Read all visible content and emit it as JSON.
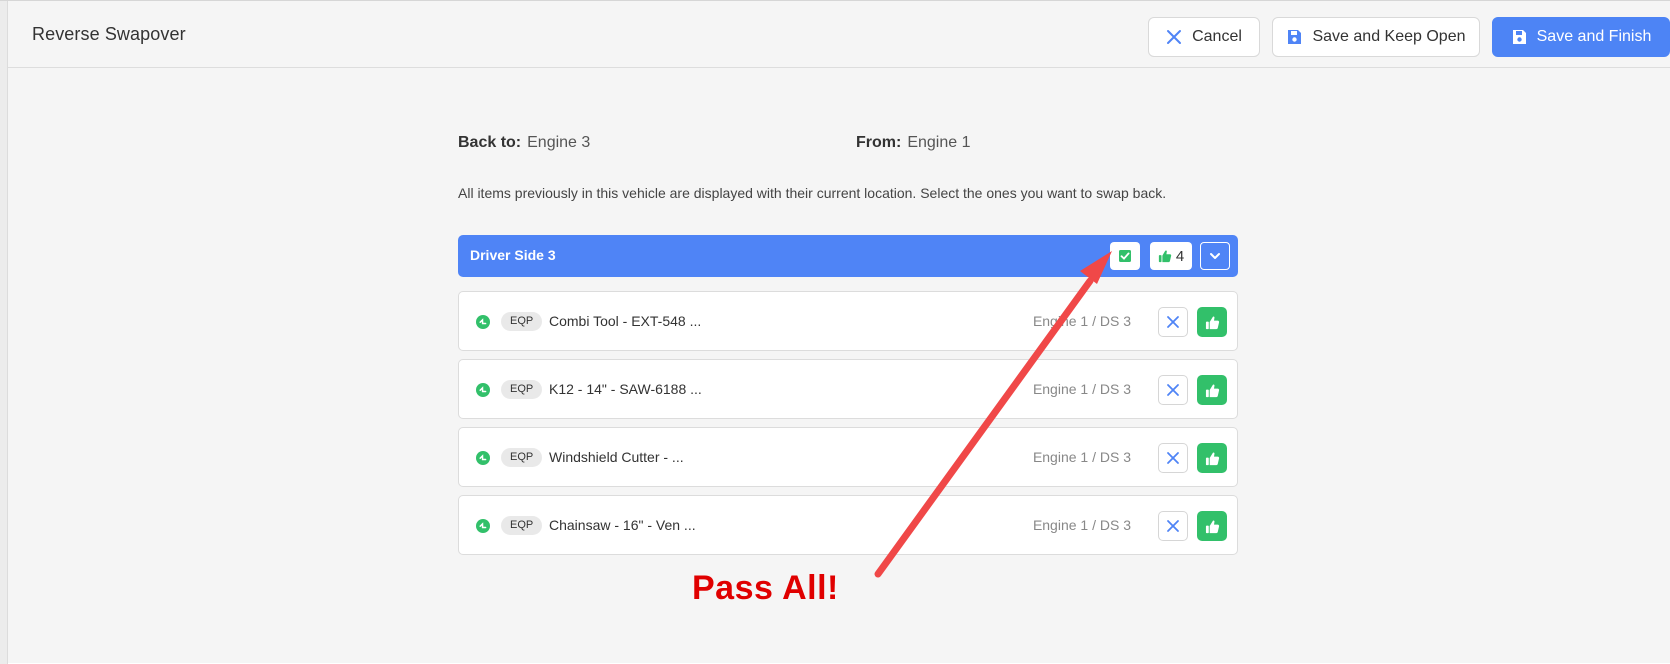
{
  "header": {
    "title": "Reverse Swapover",
    "cancel_label": "Cancel",
    "save_keep_open_label": "Save and Keep Open",
    "save_finish_label": "Save and Finish"
  },
  "meta": {
    "back_to_label": "Back to:",
    "back_to_value": "Engine 3",
    "from_label": "From:",
    "from_value": "Engine 1"
  },
  "instructions": "All items previously in this vehicle are displayed with their current location. Select the ones you want to swap back.",
  "group": {
    "title": "Driver Side 3",
    "pass_count": "4"
  },
  "items": [
    {
      "type": "EQP",
      "name": "Combi Tool - EXT-548 ...",
      "location": "Engine 1 / DS 3"
    },
    {
      "type": "EQP",
      "name": "K12 - 14\" - SAW-6188 ...",
      "location": "Engine 1 / DS 3"
    },
    {
      "type": "EQP",
      "name": "Windshield Cutter - ...",
      "location": "Engine 1 / DS 3"
    },
    {
      "type": "EQP",
      "name": "Chainsaw - 16\" - Ven ...",
      "location": "Engine 1 / DS 3"
    }
  ],
  "annotation": {
    "text": "Pass All!"
  },
  "colors": {
    "primary": "#4f84f6",
    "success": "#32c06a",
    "annotation": "#e00000"
  },
  "icons": {
    "cancel": "close-icon",
    "save": "floppy-disk-icon",
    "pass_all": "check-square-icon",
    "thumbs_up": "thumbs-up-icon",
    "toggle": "chevron-down-icon",
    "status": "status-dot-icon"
  }
}
